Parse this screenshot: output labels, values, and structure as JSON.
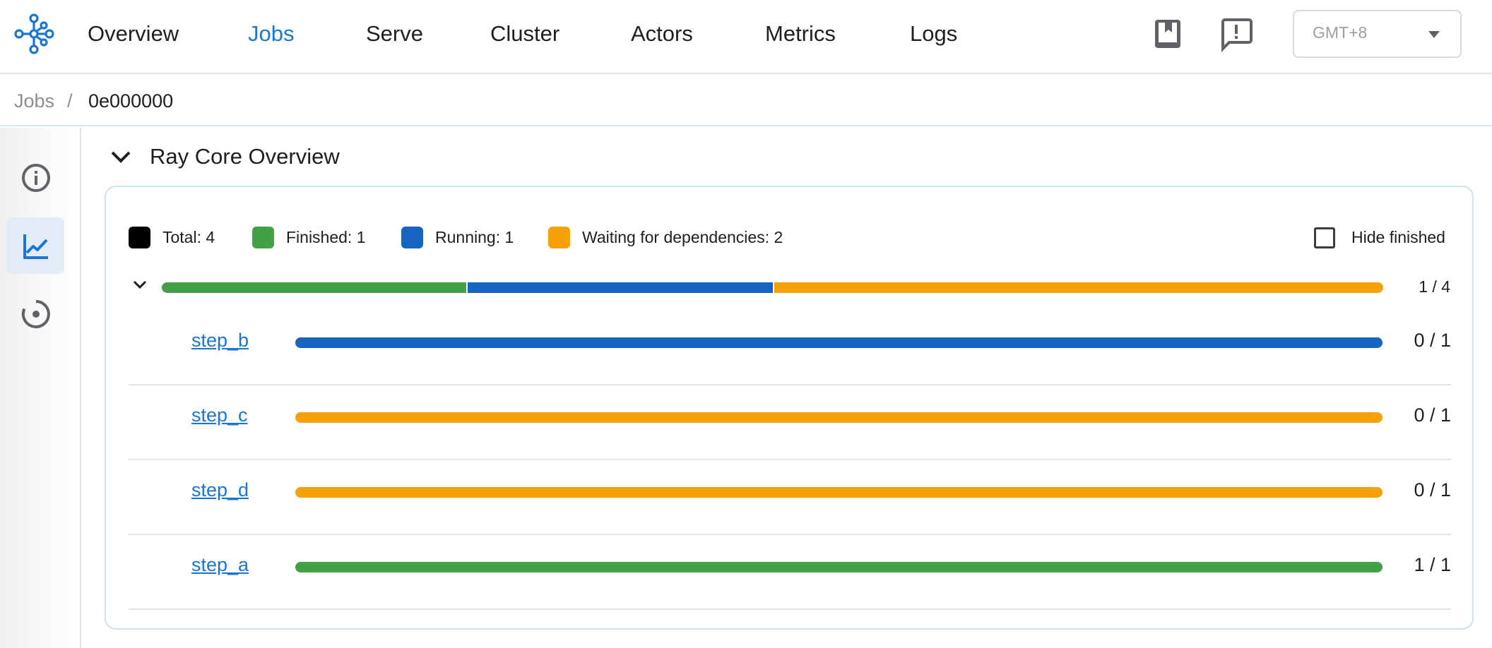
{
  "nav": {
    "items": [
      {
        "label": "Overview",
        "active": false
      },
      {
        "label": "Jobs",
        "active": true
      },
      {
        "label": "Serve",
        "active": false
      },
      {
        "label": "Cluster",
        "active": false
      },
      {
        "label": "Actors",
        "active": false
      },
      {
        "label": "Metrics",
        "active": false
      },
      {
        "label": "Logs",
        "active": false
      }
    ],
    "icons": [
      "docs-book-icon",
      "feedback-icon"
    ],
    "timezone": {
      "value": "GMT+8"
    }
  },
  "breadcrumb": {
    "root": "Jobs",
    "separator": "/",
    "current": "0e000000"
  },
  "siderail": {
    "items": [
      {
        "icon": "info-icon",
        "active": false
      },
      {
        "icon": "chart-line-icon",
        "active": true
      },
      {
        "icon": "target-icon",
        "active": false
      }
    ]
  },
  "section": {
    "title": "Ray Core Overview",
    "expanded": true
  },
  "legend": [
    {
      "label": "Total: 4",
      "color": "#000000"
    },
    {
      "label": "Finished: 1",
      "color": "#43a047"
    },
    {
      "label": "Running: 1",
      "color": "#1565c0"
    },
    {
      "label": "Waiting for dependencies: 2",
      "color": "#f5a10a"
    }
  ],
  "hide_finished": {
    "label": "Hide finished",
    "checked": false
  },
  "overall": {
    "count": "1 / 4",
    "segments": [
      {
        "state": "finished",
        "value": 1,
        "color": "#43a047"
      },
      {
        "state": "running",
        "value": 1,
        "color": "#1565c0"
      },
      {
        "state": "waiting",
        "value": 2,
        "color": "#f5a10a"
      }
    ]
  },
  "tasks": [
    {
      "name": "step_b",
      "count": "0 / 1",
      "state": "running",
      "color": "#1565c0"
    },
    {
      "name": "step_c",
      "count": "0 / 1",
      "state": "waiting",
      "color": "#f5a10a"
    },
    {
      "name": "step_d",
      "count": "0 / 1",
      "state": "waiting",
      "color": "#f5a10a"
    },
    {
      "name": "step_a",
      "count": "1 / 1",
      "state": "finished",
      "color": "#43a047"
    }
  ]
}
